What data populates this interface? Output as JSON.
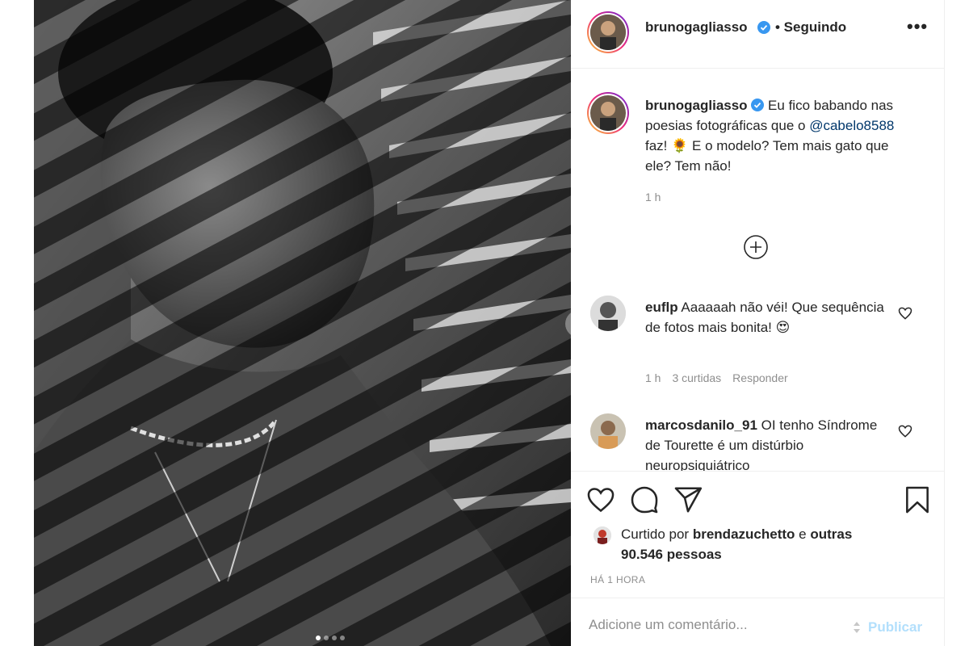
{
  "post": {
    "author": "brunogagliasso",
    "follow_status": "• Seguindo",
    "more_label": "•••",
    "caption_author": "brunogagliasso",
    "caption_part1": "Eu fico babando nas poesias fotográficas que o",
    "caption_mention": "@cabelo8588",
    "caption_part2": "faz! 🌻 E o modelo? Tem mais gato que ele? Tem não!",
    "caption_time": "1 h",
    "carousel_dots": 4,
    "carousel_active": 1
  },
  "comments": [
    {
      "user": "euflp",
      "text": "Aaaaaah não véi! Que sequência de fotos mais bonita! 😍",
      "time": "1 h",
      "likes": "3 curtidas",
      "reply": "Responder"
    },
    {
      "user": "marcosdanilo_91",
      "text": "OI tenho Síndrome de Tourette é um distúrbio neuropsiquiátrico"
    }
  ],
  "likes": {
    "prefix": "Curtido por",
    "user": "brendazuchetto",
    "joiner": "e",
    "others": "outras 90.546 pessoas"
  },
  "posted_ago": "HÁ 1 HORA",
  "add_comment": {
    "placeholder": "Adicione um comentário...",
    "publish_label": "Publicar"
  },
  "icons": {
    "like": "heart-icon",
    "comment": "comment-icon",
    "share": "paper-plane-icon",
    "save": "bookmark-icon",
    "verified": "verified-badge-icon",
    "expand": "plus-circle-icon",
    "next": "chevron-right-icon"
  },
  "colors": {
    "verified": "#3897f0",
    "mention": "#00376b",
    "muted": "#8e8e8e",
    "publish_disabled": "#b2dffc"
  }
}
